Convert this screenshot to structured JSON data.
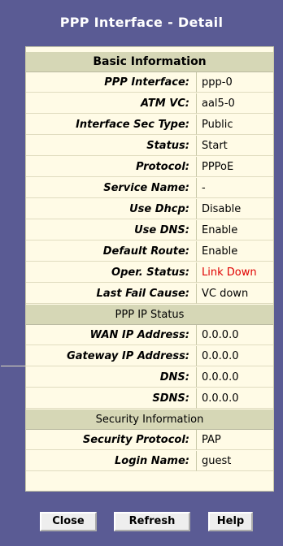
{
  "title": "PPP Interface - Detail",
  "sections": {
    "basic": "Basic Information",
    "ppp_ip": "PPP IP Status",
    "security": "Security Information"
  },
  "basic_rows": [
    {
      "label": "PPP Interface:",
      "value": "ppp-0"
    },
    {
      "label": "ATM VC:",
      "value": "aal5-0"
    },
    {
      "label": "Interface Sec Type:",
      "value": "Public"
    },
    {
      "label": "Status:",
      "value": "Start"
    },
    {
      "label": "Protocol:",
      "value": "PPPoE"
    },
    {
      "label": "Service Name:",
      "value": "-"
    },
    {
      "label": "Use Dhcp:",
      "value": "Disable"
    },
    {
      "label": "Use DNS:",
      "value": "Enable"
    },
    {
      "label": "Default Route:",
      "value": "Enable"
    },
    {
      "label": "Oper. Status:",
      "value": "Link Down"
    },
    {
      "label": "Last Fail Cause:",
      "value": "VC down"
    }
  ],
  "ip_rows": [
    {
      "label": "WAN IP Address:",
      "value": "0.0.0.0"
    },
    {
      "label": "Gateway IP Address:",
      "value": "0.0.0.0"
    },
    {
      "label": "DNS:",
      "value": "0.0.0.0"
    },
    {
      "label": "SDNS:",
      "value": "0.0.0.0"
    }
  ],
  "security_rows": [
    {
      "label": "Security Protocol:",
      "value": "PAP"
    },
    {
      "label": "Login Name:",
      "value": "guest"
    }
  ],
  "buttons": {
    "close": "Close",
    "refresh": "Refresh",
    "help": "Help"
  },
  "colors": {
    "panel": "#5a5b94",
    "table_bg": "#fffbe6",
    "section_bg": "#d6d7b6",
    "alert_text": "#e00000"
  }
}
